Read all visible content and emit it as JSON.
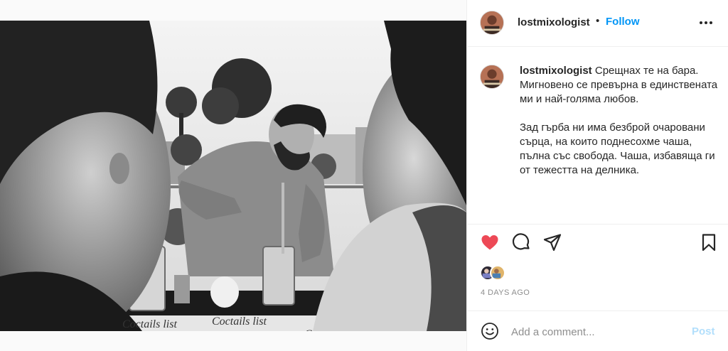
{
  "photo": {
    "alt": "",
    "menu_signs": [
      "Coctails list",
      "Coctails list",
      "Co"
    ]
  },
  "header": {
    "username": "lostmixologist",
    "separator": "•",
    "follow_label": "Follow",
    "more_icon": "more-horizontal-icon"
  },
  "caption": {
    "username": "lostmixologist",
    "paragraph1": "Срещнах те на бара. Мигновено се превърна в единствената ми и най-голяма любов.",
    "paragraph2": "Зад гърба ни има безброй очаровани сърца, на които поднесохме чаша, пълна със свобода. Чаша, избавяща ги от тежестта на делника."
  },
  "actions": {
    "like_icon": "heart-filled-icon",
    "comment_icon": "comment-icon",
    "share_icon": "share-icon",
    "save_icon": "bookmark-icon",
    "like_color": "#ed4956"
  },
  "meta": {
    "timestamp": "4 DAYS AGO"
  },
  "comment": {
    "placeholder": "Add a comment...",
    "post_label": "Post",
    "post_color": "#b2dffc",
    "emoji_icon": "emoji-smile-icon"
  },
  "colors": {
    "link_blue": "#0095f6",
    "border": "#efefef",
    "muted": "#8e8e8e"
  }
}
